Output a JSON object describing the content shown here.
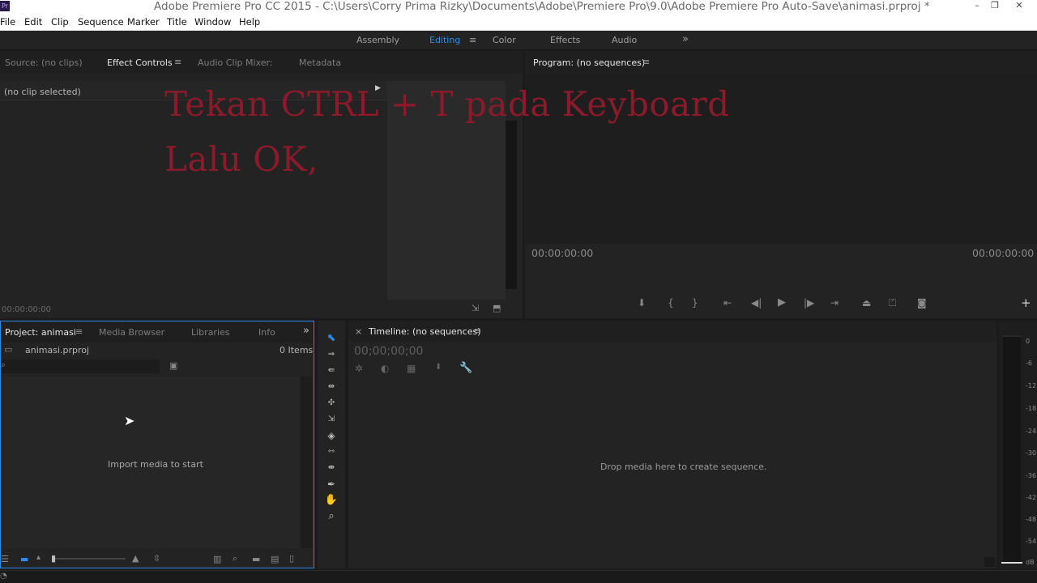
{
  "window": {
    "app_icon": "Pr",
    "title": "Adobe Premiere Pro CC 2015 - C:\\Users\\Corry Prima Rizky\\Documents\\Adobe\\Premiere Pro\\9.0\\Adobe Premiere Pro Auto-Save\\animasi.prproj *",
    "minimize": "–",
    "restore": "❐",
    "close": "✕"
  },
  "menu": {
    "items": [
      "File",
      "Edit",
      "Clip",
      "Sequence",
      "Marker",
      "Title",
      "Window",
      "Help"
    ]
  },
  "workspace": {
    "tabs": [
      "Assembly",
      "Editing",
      "Color",
      "Effects",
      "Audio"
    ],
    "active": "Editing",
    "menu_icon": "≡",
    "more_icon": "»"
  },
  "source_panel": {
    "tabs": [
      "Source: (no clips)",
      "Effect Controls",
      "Audio Clip Mixer:",
      "Metadata"
    ],
    "active_tab": "Effect Controls",
    "no_clip": "(no clip selected)",
    "timecode": "00:00:00:00"
  },
  "program_panel": {
    "title": "Program: (no sequences)",
    "timecode_left": "00:00:00:00",
    "timecode_right": "00:00:00:00",
    "add_icon": "+"
  },
  "project_panel": {
    "tabs": [
      "Project: animasi",
      "Media Browser",
      "Libraries",
      "Info"
    ],
    "active_tab": "Project: animasi",
    "file_name": "animasi.prproj",
    "item_count": "0 Items",
    "empty_text": "Import media to start"
  },
  "timeline_panel": {
    "close_icon": "×",
    "title": "Timeline: (no sequences)",
    "timecode": "00;00;00;00",
    "drop_text": "Drop media here to create sequence."
  },
  "audio_meter": {
    "labels": [
      "0",
      "-6",
      "-12",
      "-18",
      "-24",
      "-30",
      "-36",
      "-42",
      "-48",
      "-54",
      "dB"
    ]
  },
  "overlay": {
    "line1": "Tekan CTRL + T pada Keyboard",
    "line2": "Lalu OK,"
  },
  "colors": {
    "accent": "#2d8ceb",
    "overlay_text": "#8b1a2b",
    "panel_bg": "#232323",
    "app_bg": "#1b1b1b"
  }
}
